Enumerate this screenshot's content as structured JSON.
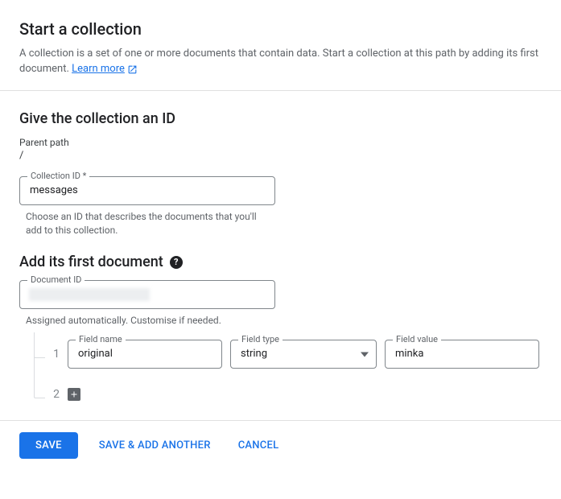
{
  "header": {
    "title": "Start a collection",
    "description": "A collection is a set of one or more documents that contain data. Start a collection at this path by adding its first document. ",
    "learnMore": "Learn more"
  },
  "collectionSection": {
    "title": "Give the collection an ID",
    "parentLabel": "Parent path",
    "parentPath": "/",
    "collectionIdLabel": "Collection ID *",
    "collectionIdValue": "messages",
    "collectionIdHelper": "Choose an ID that describes the documents that you'll add to this collection."
  },
  "documentSection": {
    "title": "Add its first document",
    "documentIdLabel": "Document ID",
    "documentIdValue": "",
    "documentIdHelper": "Assigned automatically. Customise if needed.",
    "fields": {
      "row1Num": "1",
      "row2Num": "2",
      "nameLabel": "Field name",
      "nameValue": "original",
      "typeLabel": "Field type",
      "typeValue": "string",
      "valueLabel": "Field value",
      "valueValue": "minka"
    }
  },
  "footer": {
    "save": "Save",
    "saveAnother": "Save & add another",
    "cancel": "Cancel"
  }
}
